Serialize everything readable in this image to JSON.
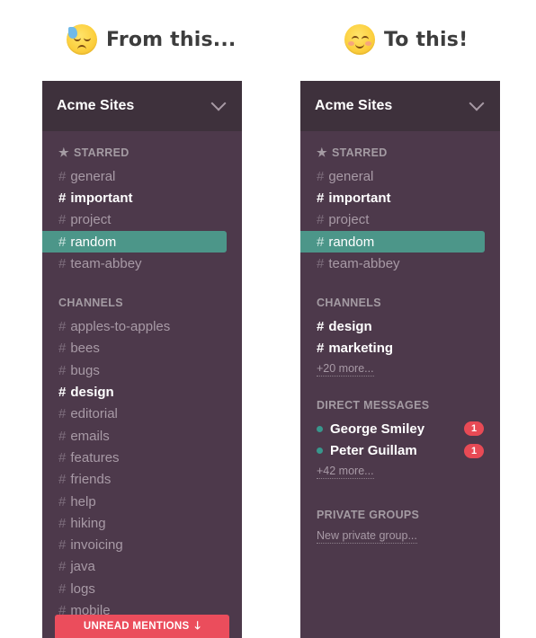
{
  "captions": {
    "left": "From this...",
    "right": "To this!"
  },
  "left_sidebar": {
    "team_name": "Acme Sites",
    "starred_title": "STARRED",
    "starred": [
      {
        "label": "general",
        "state": "normal"
      },
      {
        "label": "important",
        "state": "bold"
      },
      {
        "label": "project",
        "state": "normal"
      },
      {
        "label": "random",
        "state": "active"
      },
      {
        "label": "team-abbey",
        "state": "normal"
      }
    ],
    "channels_title": "CHANNELS",
    "channels": [
      {
        "label": "apples-to-apples",
        "state": "normal"
      },
      {
        "label": "bees",
        "state": "normal"
      },
      {
        "label": "bugs",
        "state": "normal"
      },
      {
        "label": "design",
        "state": "bold"
      },
      {
        "label": "editorial",
        "state": "normal"
      },
      {
        "label": "emails",
        "state": "normal"
      },
      {
        "label": "features",
        "state": "normal"
      },
      {
        "label": "friends",
        "state": "normal"
      },
      {
        "label": "help",
        "state": "normal"
      },
      {
        "label": "hiking",
        "state": "normal"
      },
      {
        "label": "invoicing",
        "state": "normal"
      },
      {
        "label": "java",
        "state": "normal"
      },
      {
        "label": "logs",
        "state": "normal"
      },
      {
        "label": "mobile",
        "state": "normal"
      }
    ],
    "unread_mentions": "UNREAD MENTIONS"
  },
  "right_sidebar": {
    "team_name": "Acme Sites",
    "starred_title": "STARRED",
    "starred": [
      {
        "label": "general",
        "state": "normal"
      },
      {
        "label": "important",
        "state": "bold"
      },
      {
        "label": "project",
        "state": "normal"
      },
      {
        "label": "random",
        "state": "active"
      },
      {
        "label": "team-abbey",
        "state": "normal"
      }
    ],
    "channels_title": "CHANNELS",
    "channels": [
      {
        "label": "design",
        "state": "bold"
      },
      {
        "label": "marketing",
        "state": "bold"
      }
    ],
    "channels_more": "+20 more...",
    "dm_title": "DIRECT MESSAGES",
    "dms": [
      {
        "name": "George Smiley",
        "badge": "1"
      },
      {
        "name": "Peter Guillam",
        "badge": "1"
      }
    ],
    "dm_more": "+42 more...",
    "groups_title": "PRIVATE GROUPS",
    "new_group": "New private group..."
  },
  "colors": {
    "sidebar": "#4d394b",
    "header": "#3e313c",
    "active": "#4c9689",
    "badge": "#e84a55",
    "presence": "#38978d"
  }
}
